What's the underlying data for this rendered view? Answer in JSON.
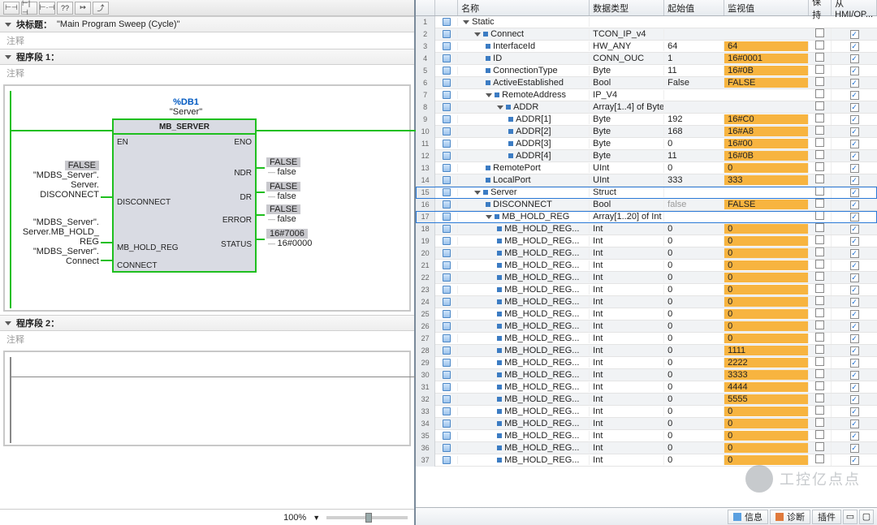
{
  "left": {
    "toolbar_icons": [
      "⊢⊣",
      "⊢|⊣",
      "⊢·⊣",
      "??",
      "↦",
      "⤴"
    ],
    "block_title_label": "块标题：",
    "block_title": "\"Main Program Sweep (Cycle)\"",
    "comment": "注释",
    "seg1": "程序段 1：",
    "seg2": "程序段 2：",
    "db": "%DB1",
    "dbname": "\"Server\"",
    "fb": "MB_SERVER",
    "pins_left": [
      "EN",
      "DISCONNECT",
      "MB_HOLD_REG",
      "CONNECT"
    ],
    "pins_right": [
      "ENO",
      "NDR",
      "DR",
      "ERROR",
      "STATUS"
    ],
    "labels": {
      "disconnect": [
        "FALSE",
        "\"MDBS_Server\".",
        "Server.",
        "DISCONNECT"
      ],
      "hold": [
        "\"MDBS_Server\".",
        "Server.MB_HOLD_",
        "REG"
      ],
      "connect": [
        "\"MDBS_Server\".",
        "Connect"
      ]
    },
    "outs": {
      "ndr": {
        "v": "FALSE",
        "s": "false"
      },
      "dr": {
        "v": "FALSE",
        "s": "false"
      },
      "error": {
        "v": "FALSE",
        "s": "false"
      },
      "status": {
        "v": "16#7006",
        "s": "16#0000"
      }
    },
    "zoom": "100%"
  },
  "right": {
    "headers": {
      "name": "名称",
      "type": "数据类型",
      "start": "起始值",
      "mon": "监视值",
      "keep": "保持",
      "hmi": "从 HMI/OP..."
    },
    "status": {
      "info": "信息",
      "diag": "诊断",
      "plugin": "插件"
    },
    "watermark": "工控亿点点",
    "rows": [
      {
        "n": 1,
        "ind": 0,
        "exp": "d",
        "sq": false,
        "name": "Static",
        "type": "",
        "start": "",
        "mon": "",
        "hl": false,
        "keep": null,
        "hmi": null
      },
      {
        "n": 2,
        "ind": 1,
        "exp": "d",
        "sq": true,
        "name": "Connect",
        "type": "TCON_IP_v4",
        "start": "",
        "mon": "",
        "hl": false,
        "keep": false,
        "hmi": true
      },
      {
        "n": 3,
        "ind": 2,
        "exp": "",
        "sq": true,
        "name": "InterfaceId",
        "type": "HW_ANY",
        "start": "64",
        "mon": "64",
        "hl": true,
        "keep": false,
        "hmi": true
      },
      {
        "n": 4,
        "ind": 2,
        "exp": "",
        "sq": true,
        "name": "ID",
        "type": "CONN_OUC",
        "start": "1",
        "mon": "16#0001",
        "hl": true,
        "keep": false,
        "hmi": true
      },
      {
        "n": 5,
        "ind": 2,
        "exp": "",
        "sq": true,
        "name": "ConnectionType",
        "type": "Byte",
        "start": "11",
        "mon": "16#0B",
        "hl": true,
        "keep": false,
        "hmi": true
      },
      {
        "n": 6,
        "ind": 2,
        "exp": "",
        "sq": true,
        "name": "ActiveEstablished",
        "type": "Bool",
        "start": "False",
        "mon": "FALSE",
        "hl": true,
        "keep": false,
        "hmi": true
      },
      {
        "n": 7,
        "ind": 2,
        "exp": "d",
        "sq": true,
        "name": "RemoteAddress",
        "type": "IP_V4",
        "start": "",
        "mon": "",
        "hl": false,
        "keep": false,
        "hmi": true
      },
      {
        "n": 8,
        "ind": 3,
        "exp": "d",
        "sq": true,
        "name": "ADDR",
        "type": "Array[1..4] of Byte",
        "start": "",
        "mon": "",
        "hl": false,
        "keep": false,
        "hmi": true
      },
      {
        "n": 9,
        "ind": 4,
        "exp": "",
        "sq": true,
        "name": "ADDR[1]",
        "type": "Byte",
        "start": "192",
        "mon": "16#C0",
        "hl": true,
        "keep": false,
        "hmi": true
      },
      {
        "n": 10,
        "ind": 4,
        "exp": "",
        "sq": true,
        "name": "ADDR[2]",
        "type": "Byte",
        "start": "168",
        "mon": "16#A8",
        "hl": true,
        "keep": false,
        "hmi": true
      },
      {
        "n": 11,
        "ind": 4,
        "exp": "",
        "sq": true,
        "name": "ADDR[3]",
        "type": "Byte",
        "start": "0",
        "mon": "16#00",
        "hl": true,
        "keep": false,
        "hmi": true
      },
      {
        "n": 12,
        "ind": 4,
        "exp": "",
        "sq": true,
        "name": "ADDR[4]",
        "type": "Byte",
        "start": "11",
        "mon": "16#0B",
        "hl": true,
        "keep": false,
        "hmi": true
      },
      {
        "n": 13,
        "ind": 2,
        "exp": "",
        "sq": true,
        "name": "RemotePort",
        "type": "UInt",
        "start": "0",
        "mon": "0",
        "hl": true,
        "keep": false,
        "hmi": true
      },
      {
        "n": 14,
        "ind": 2,
        "exp": "",
        "sq": true,
        "name": "LocalPort",
        "type": "UInt",
        "start": "333",
        "mon": "333",
        "hl": true,
        "keep": false,
        "hmi": true
      },
      {
        "n": 15,
        "ind": 1,
        "exp": "d",
        "sq": true,
        "name": "Server",
        "type": "Struct",
        "start": "",
        "mon": "",
        "hl": false,
        "keep": false,
        "hmi": true,
        "sel": true
      },
      {
        "n": 16,
        "ind": 2,
        "exp": "",
        "sq": true,
        "name": "DISCONNECT",
        "type": "Bool",
        "start": "false",
        "mon": "FALSE",
        "hl": true,
        "keep": false,
        "hmi": true
      },
      {
        "n": 17,
        "ind": 2,
        "exp": "d",
        "sq": true,
        "name": "MB_HOLD_REG",
        "type": "Array[1..20] of Int",
        "start": "",
        "mon": "",
        "hl": false,
        "keep": false,
        "hmi": true,
        "sel": true
      },
      {
        "n": 18,
        "ind": 3,
        "exp": "",
        "sq": true,
        "name": "MB_HOLD_REG...",
        "type": "Int",
        "start": "0",
        "mon": "0",
        "hl": true,
        "keep": false,
        "hmi": true
      },
      {
        "n": 19,
        "ind": 3,
        "exp": "",
        "sq": true,
        "name": "MB_HOLD_REG...",
        "type": "Int",
        "start": "0",
        "mon": "0",
        "hl": true,
        "keep": false,
        "hmi": true
      },
      {
        "n": 20,
        "ind": 3,
        "exp": "",
        "sq": true,
        "name": "MB_HOLD_REG...",
        "type": "Int",
        "start": "0",
        "mon": "0",
        "hl": true,
        "keep": false,
        "hmi": true
      },
      {
        "n": 21,
        "ind": 3,
        "exp": "",
        "sq": true,
        "name": "MB_HOLD_REG...",
        "type": "Int",
        "start": "0",
        "mon": "0",
        "hl": true,
        "keep": false,
        "hmi": true
      },
      {
        "n": 22,
        "ind": 3,
        "exp": "",
        "sq": true,
        "name": "MB_HOLD_REG...",
        "type": "Int",
        "start": "0",
        "mon": "0",
        "hl": true,
        "keep": false,
        "hmi": true
      },
      {
        "n": 23,
        "ind": 3,
        "exp": "",
        "sq": true,
        "name": "MB_HOLD_REG...",
        "type": "Int",
        "start": "0",
        "mon": "0",
        "hl": true,
        "keep": false,
        "hmi": true
      },
      {
        "n": 24,
        "ind": 3,
        "exp": "",
        "sq": true,
        "name": "MB_HOLD_REG...",
        "type": "Int",
        "start": "0",
        "mon": "0",
        "hl": true,
        "keep": false,
        "hmi": true
      },
      {
        "n": 25,
        "ind": 3,
        "exp": "",
        "sq": true,
        "name": "MB_HOLD_REG...",
        "type": "Int",
        "start": "0",
        "mon": "0",
        "hl": true,
        "keep": false,
        "hmi": true
      },
      {
        "n": 26,
        "ind": 3,
        "exp": "",
        "sq": true,
        "name": "MB_HOLD_REG...",
        "type": "Int",
        "start": "0",
        "mon": "0",
        "hl": true,
        "keep": false,
        "hmi": true
      },
      {
        "n": 27,
        "ind": 3,
        "exp": "",
        "sq": true,
        "name": "MB_HOLD_REG...",
        "type": "Int",
        "start": "0",
        "mon": "0",
        "hl": true,
        "keep": false,
        "hmi": true
      },
      {
        "n": 28,
        "ind": 3,
        "exp": "",
        "sq": true,
        "name": "MB_HOLD_REG...",
        "type": "Int",
        "start": "0",
        "mon": "1111",
        "hl": true,
        "keep": false,
        "hmi": true
      },
      {
        "n": 29,
        "ind": 3,
        "exp": "",
        "sq": true,
        "name": "MB_HOLD_REG...",
        "type": "Int",
        "start": "0",
        "mon": "2222",
        "hl": true,
        "keep": false,
        "hmi": true
      },
      {
        "n": 30,
        "ind": 3,
        "exp": "",
        "sq": true,
        "name": "MB_HOLD_REG...",
        "type": "Int",
        "start": "0",
        "mon": "3333",
        "hl": true,
        "keep": false,
        "hmi": true
      },
      {
        "n": 31,
        "ind": 3,
        "exp": "",
        "sq": true,
        "name": "MB_HOLD_REG...",
        "type": "Int",
        "start": "0",
        "mon": "4444",
        "hl": true,
        "keep": false,
        "hmi": true
      },
      {
        "n": 32,
        "ind": 3,
        "exp": "",
        "sq": true,
        "name": "MB_HOLD_REG...",
        "type": "Int",
        "start": "0",
        "mon": "5555",
        "hl": true,
        "keep": false,
        "hmi": true
      },
      {
        "n": 33,
        "ind": 3,
        "exp": "",
        "sq": true,
        "name": "MB_HOLD_REG...",
        "type": "Int",
        "start": "0",
        "mon": "0",
        "hl": true,
        "keep": false,
        "hmi": true
      },
      {
        "n": 34,
        "ind": 3,
        "exp": "",
        "sq": true,
        "name": "MB_HOLD_REG...",
        "type": "Int",
        "start": "0",
        "mon": "0",
        "hl": true,
        "keep": false,
        "hmi": true
      },
      {
        "n": 35,
        "ind": 3,
        "exp": "",
        "sq": true,
        "name": "MB_HOLD_REG...",
        "type": "Int",
        "start": "0",
        "mon": "0",
        "hl": true,
        "keep": false,
        "hmi": true
      },
      {
        "n": 36,
        "ind": 3,
        "exp": "",
        "sq": true,
        "name": "MB_HOLD_REG...",
        "type": "Int",
        "start": "0",
        "mon": "0",
        "hl": true,
        "keep": false,
        "hmi": true
      },
      {
        "n": 37,
        "ind": 3,
        "exp": "",
        "sq": true,
        "name": "MB_HOLD_REG...",
        "type": "Int",
        "start": "0",
        "mon": "0",
        "hl": true,
        "keep": false,
        "hmi": true
      }
    ]
  }
}
